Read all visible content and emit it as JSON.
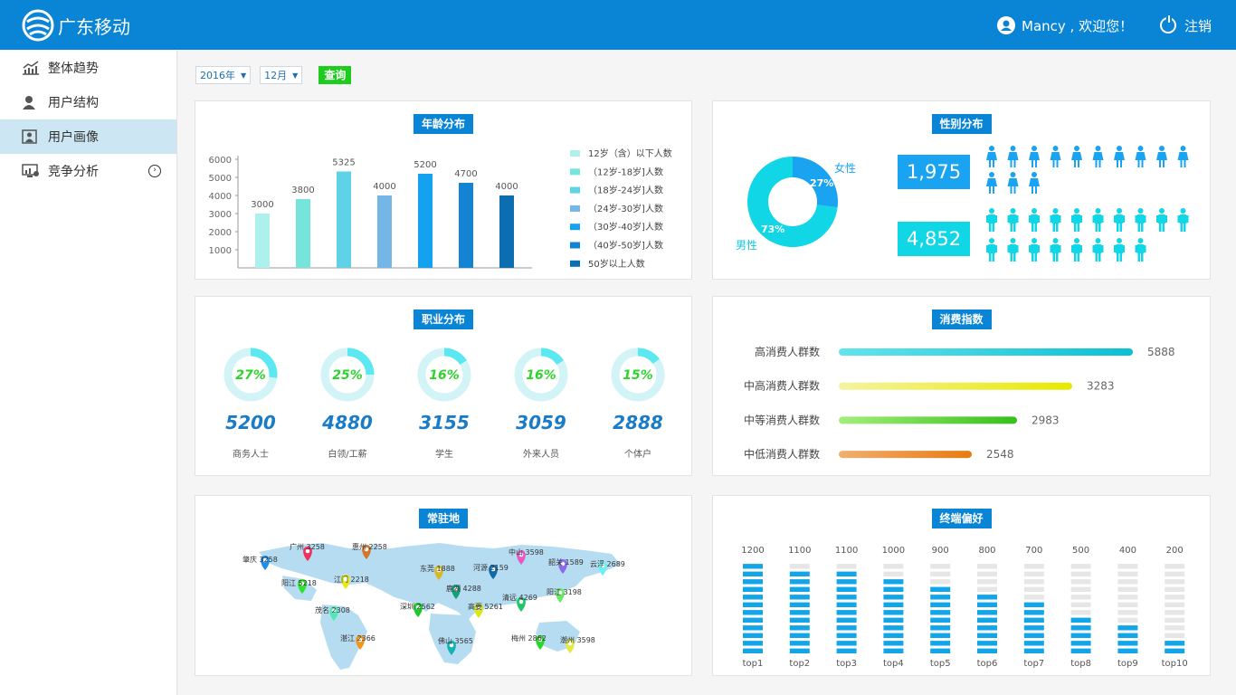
{
  "app": {
    "brand": "广东移动",
    "user_greeting": "Mancy , 欢迎您！",
    "logout": "注销"
  },
  "sidebar": {
    "items": [
      {
        "label": "整体趋势",
        "icon": "trend-chart-icon"
      },
      {
        "label": "用户结构",
        "icon": "user-icon"
      },
      {
        "label": "用户画像",
        "icon": "portrait-icon",
        "active": true
      },
      {
        "label": "竞争分析",
        "icon": "monitor-chart-icon",
        "chevron": "chevron-right-icon"
      }
    ]
  },
  "filters": {
    "year": "2016年",
    "month": "12月",
    "query": "查询"
  },
  "panels": {
    "age": {
      "title": "年龄分布"
    },
    "gender": {
      "title": "性别分布",
      "female_label": "女性",
      "male_label": "男性",
      "female_count": "1,975",
      "male_count": "4,852",
      "female_pct": "27%",
      "male_pct": "73%"
    },
    "job": {
      "title": "职业分布"
    },
    "consume": {
      "title": "消费指数"
    },
    "map": {
      "title": "常驻地"
    },
    "terminal": {
      "title": "终端偏好"
    }
  },
  "chart_data": [
    {
      "type": "bar",
      "title": "年龄分布",
      "categories": [
        "12岁（含）以下人数",
        "（12岁-18岁]人数",
        "（18岁-24岁]人数",
        "（24岁-30岁]人数",
        "（30岁-40岁]人数",
        "（40岁-50岁]人数",
        "50岁以上人数"
      ],
      "values": [
        3000,
        3800,
        5325,
        4000,
        5200,
        4700,
        4000
      ],
      "yticks": [
        1000,
        2000,
        3000,
        4000,
        5000,
        6000
      ],
      "ylim": [
        0,
        6000
      ],
      "colors": [
        "#aef0ec",
        "#77e4dc",
        "#60d2e8",
        "#74b6e6",
        "#14a2f0",
        "#1383d4",
        "#0a6eb0"
      ],
      "legend": "right"
    },
    {
      "type": "pie",
      "title": "性别分布",
      "slices": [
        {
          "name": "女性",
          "value": 27,
          "color": "#1aa3f0"
        },
        {
          "name": "男性",
          "value": 73,
          "color": "#10d6e6"
        }
      ]
    },
    {
      "type": "donut-gauges",
      "title": "职业分布",
      "items": [
        {
          "name": "商务人士",
          "value": 5200,
          "pct": 27
        },
        {
          "name": "白领/工薪",
          "value": 4880,
          "pct": 25
        },
        {
          "name": "学生",
          "value": 3155,
          "pct": 16
        },
        {
          "name": "外来人员",
          "value": 3059,
          "pct": 16
        },
        {
          "name": "个体户",
          "value": 2888,
          "pct": 15
        }
      ]
    },
    {
      "type": "bar",
      "title": "消费指数",
      "categories": [
        "高消费人群数",
        "中高消费人群数",
        "中等消费人群数",
        "中低消费人群数"
      ],
      "values": [
        5888,
        3283,
        2983,
        2548
      ],
      "gradients": [
        [
          "#63e4ee",
          "#0bbfd4"
        ],
        [
          "#f4f4a0",
          "#e8e800"
        ],
        [
          "#a4ee7a",
          "#36c01a"
        ],
        [
          "#f0b070",
          "#e87a10"
        ]
      ]
    },
    {
      "type": "bar",
      "title": "终端偏好",
      "categories": [
        "top1",
        "top2",
        "top3",
        "top4",
        "top5",
        "top6",
        "top7",
        "top8",
        "top9",
        "top10"
      ],
      "values": [
        1200,
        1100,
        1100,
        1000,
        900,
        800,
        700,
        500,
        400,
        200
      ],
      "max": 1200
    }
  ],
  "map_points": [
    {
      "name": "肇庆",
      "value": 3258,
      "color": "#1e8ee8"
    },
    {
      "name": "广州",
      "value": 3258,
      "color": "#ef2f5c"
    },
    {
      "name": "惠州",
      "value": 2258,
      "color": "#d4752a"
    },
    {
      "name": "阳江",
      "value": 5218,
      "color": "#2fe02f"
    },
    {
      "name": "江门",
      "value": 2218,
      "color": "#e8e81a"
    },
    {
      "name": "茂名",
      "value": 2308,
      "color": "#52e8b6"
    },
    {
      "name": "湛江",
      "value": 2366,
      "color": "#f0961a"
    },
    {
      "name": "东莞",
      "value": 1888,
      "color": "#d8b82a"
    },
    {
      "name": "鹿湖",
      "value": 4288,
      "color": "#13a07a"
    },
    {
      "name": "深圳",
      "value": 2562,
      "color": "#1ac82a"
    },
    {
      "name": "佛山",
      "value": 3565,
      "color": "#12b4b4"
    },
    {
      "name": "河源",
      "value": 2159,
      "color": "#0e6aa8"
    },
    {
      "name": "中山",
      "value": 3598,
      "color": "#e858c8"
    },
    {
      "name": "高要",
      "value": 5261,
      "color": "#d8e81a"
    },
    {
      "name": "清远",
      "value": 4269,
      "color": "#22c46a"
    },
    {
      "name": "韶关",
      "value": 1589,
      "color": "#8a6ae8"
    },
    {
      "name": "阳江",
      "value": 3198,
      "color": "#6ae86a"
    },
    {
      "name": "云浮",
      "value": 2689,
      "color": "#6af0f0"
    },
    {
      "name": "梅州",
      "value": 2862,
      "color": "#2ad82a"
    },
    {
      "name": "潮州",
      "value": 3598,
      "color": "#e8e846"
    }
  ]
}
